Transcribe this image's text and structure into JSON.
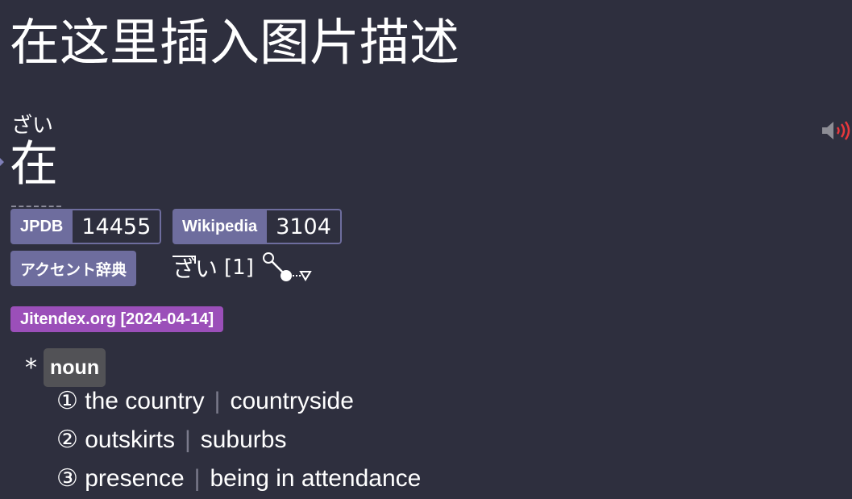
{
  "header": {
    "title": "在这里插入图片描述"
  },
  "entry": {
    "reading": "ざい",
    "term": "在",
    "audio_icon": "speaker-icon"
  },
  "frequency": {
    "jpdb": {
      "label": "JPDB",
      "value": "14455"
    },
    "wikipedia": {
      "label": "Wikipedia",
      "value": "3104"
    }
  },
  "pitch_accent": {
    "dictionary_label": "アクセント辞典",
    "kana": "ざい",
    "number": "[1]",
    "graph_icon": "pitch-graph-icon"
  },
  "definitions": {
    "dictionary_label": "Jitendex.org [2024-04-14]",
    "bullet": "*",
    "part_of_speech": "noun",
    "senses": [
      {
        "marker": "①",
        "glosses": [
          "the country",
          "countryside"
        ]
      },
      {
        "marker": "②",
        "glosses": [
          "outskirts",
          "suburbs"
        ]
      },
      {
        "marker": "③",
        "glosses": [
          "presence",
          "being in attendance"
        ]
      }
    ],
    "separator": "|"
  },
  "colors": {
    "background": "#2e2f3e",
    "tag": "#6e6d9e",
    "dictionary_tag": "#9b4fb9",
    "pos_badge": "#525256",
    "audio_accent": "#e8383d"
  }
}
